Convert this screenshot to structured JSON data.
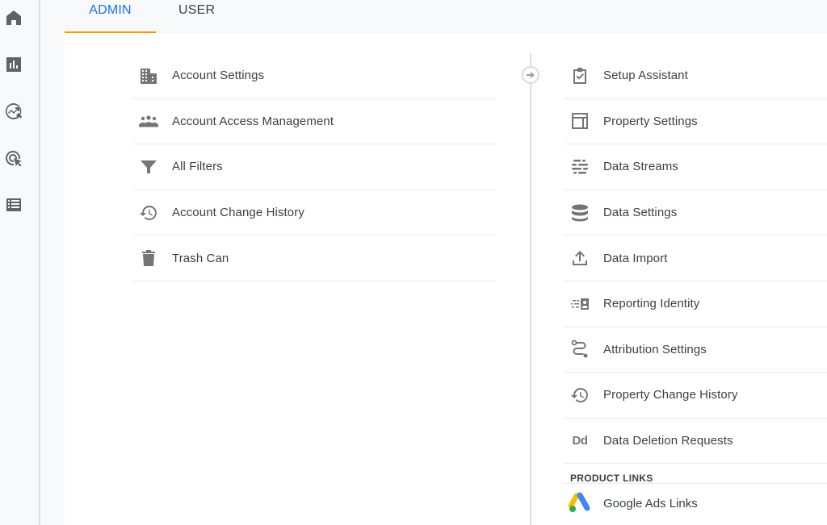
{
  "rail": {
    "items": [
      {
        "name": "home",
        "icon": "home-icon"
      },
      {
        "name": "reports",
        "icon": "bar-chart-icon"
      },
      {
        "name": "explore",
        "icon": "explore-trend-icon"
      },
      {
        "name": "advertising",
        "icon": "target-cursor-icon"
      },
      {
        "name": "configure",
        "icon": "list-icon"
      }
    ]
  },
  "tabs": [
    {
      "label": "ADMIN",
      "active": true
    },
    {
      "label": "USER",
      "active": false
    }
  ],
  "colors": {
    "accent_blue": "#1a73e8",
    "tab_underline": "#f29900",
    "icon_gray": "#757575",
    "divider": "#e8eaed"
  },
  "account_column": {
    "items": [
      {
        "label": "Account Settings",
        "icon": "building-icon"
      },
      {
        "label": "Account Access Management",
        "icon": "people-icon"
      },
      {
        "label": "All Filters",
        "icon": "filter-icon"
      },
      {
        "label": "Account Change History",
        "icon": "history-icon"
      },
      {
        "label": "Trash Can",
        "icon": "trash-icon"
      }
    ]
  },
  "property_column": {
    "items": [
      {
        "label": "Setup Assistant",
        "icon": "clipboard-check-icon"
      },
      {
        "label": "Property Settings",
        "icon": "layout-icon"
      },
      {
        "label": "Data Streams",
        "icon": "data-streams-icon"
      },
      {
        "label": "Data Settings",
        "icon": "database-icon"
      },
      {
        "label": "Data Import",
        "icon": "upload-icon"
      },
      {
        "label": "Reporting Identity",
        "icon": "reporting-identity-icon"
      },
      {
        "label": "Attribution Settings",
        "icon": "attribution-path-icon"
      },
      {
        "label": "Property Change History",
        "icon": "history-icon"
      },
      {
        "label": "Data Deletion Requests",
        "icon": "dd-icon",
        "icon_text": "Dd"
      }
    ],
    "section_heading": "PRODUCT LINKS",
    "product_links": [
      {
        "label": "Google Ads Links",
        "icon": "google-ads-icon"
      }
    ]
  }
}
